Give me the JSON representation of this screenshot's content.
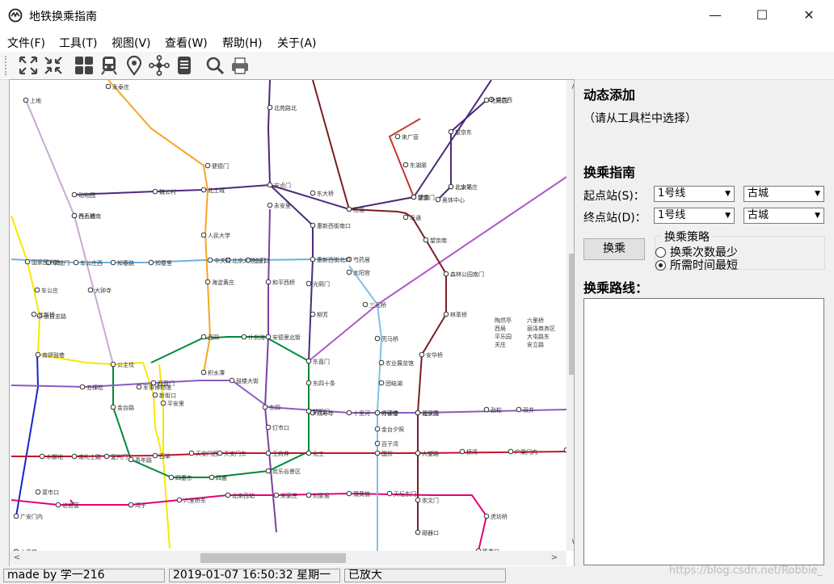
{
  "window": {
    "title": "地铁换乘指南",
    "minimize": "—",
    "maximize": "☐",
    "close": "✕"
  },
  "menu": [
    "文件(F)",
    "工具(T)",
    "视图(V)",
    "查看(W)",
    "帮助(H)",
    "关于(A)"
  ],
  "toolbar": {
    "icons": [
      "zoom-fit-icon",
      "shrink-icon",
      "grid-icon",
      "train-icon",
      "location-pin-icon",
      "network-icon",
      "document-icon",
      "search-icon",
      "printer-icon"
    ]
  },
  "map": {
    "line_colors": {
      "line1": "#c8102e",
      "line2": "#006098",
      "line4": "#008e9c",
      "line5": "#a6217f",
      "line6": "#d29700",
      "line7": "#f6c582",
      "line8": "#009b6b",
      "line9": "#8fc31f",
      "line10": "#0092c7",
      "line13": "#f9e700",
      "line14": "#d5a7a1",
      "line15": "#5b2c6f",
      "batong": "#c23a30",
      "changping": "#de82b2",
      "yizhuang": "#e40077"
    },
    "station_labels": [
      "永泰庄",
      "上地",
      "北苑路北",
      "望京西",
      "望京东",
      "来广营",
      "东湖渠",
      "望京",
      "阜通",
      "望京南",
      "健德门",
      "北土城",
      "安贞门",
      "惠新西街南口",
      "惠新西街北口",
      "和平西桥",
      "光熙门",
      "柳芳",
      "芍药居",
      "太阳宫",
      "三元桥",
      "亮马桥",
      "农业展览馆",
      "团结湖",
      "呼家楼",
      "金台夕照",
      "国贸",
      "大望路",
      "朝阳门",
      "东四十条",
      "东直门",
      "东四",
      "灯市口",
      "王府井",
      "天安门东",
      "天安门西",
      "西单",
      "复兴门",
      "南礼士路",
      "木樨地",
      "军事博物馆",
      "公主坟",
      "五棵松",
      "西直门",
      "新街口",
      "平安里",
      "西四",
      "积水潭",
      "鼓楼大街",
      "安德里北街",
      "什刹海",
      "南锣鼓巷",
      "北新桥",
      "张自忠路",
      "车公庄",
      "车公庄西",
      "阜成门",
      "白石桥南",
      "国家图书馆",
      "动物园",
      "魏公村",
      "人民大学",
      "海淀黄庄",
      "中关村",
      "北京大学东门",
      "五道口",
      "知春路",
      "知春里",
      "大钟寺",
      "西土城",
      "牡丹园",
      "北太平庄",
      "奥体中心",
      "森林公园南门",
      "林萃桥",
      "安华桥",
      "北沙滩",
      "崇文门",
      "磁器口",
      "天坛东门",
      "蒲黄榆",
      "刘家窑",
      "宋家庄",
      "北京西站",
      "六里桥东",
      "湾子",
      "达官营",
      "广安门内",
      "菜市口",
      "虎坊桥",
      "珠市口",
      "桥湾",
      "广渠门内",
      "广渠门外",
      "双井",
      "劲松",
      "潘家园",
      "十里河",
      "分钟寺",
      "成寿寺",
      "化工",
      "百子湾",
      "欢乐谷景区",
      "四惠",
      "四惠东",
      "青年路",
      "十里堡",
      "金台路",
      "红庙",
      "东大桥",
      "永安里",
      "建国门",
      "北京站",
      "陶然亭",
      "六里桥",
      "西局",
      "丽泽商务区",
      "平乐园",
      "大屯路东",
      "关庄",
      "安立路"
    ]
  },
  "panel": {
    "dynamic_title": "动态添加",
    "dynamic_hint": "（请从工具栏中选择）",
    "guide_title": "换乘指南",
    "start_label": "起点站(S)：",
    "end_label": "终点站(D)：",
    "start_line": "1号线",
    "start_station": "古城",
    "end_line": "1号线",
    "end_station": "古城",
    "transfer_button": "换乘",
    "strategy_title": "换乘策略",
    "strategy_options": [
      "换乘次数最少",
      "所需时间最短"
    ],
    "strategy_selected": 1,
    "route_title": "换乘路线："
  },
  "status": {
    "author": "made by 学一216",
    "datetime": "2019-01-07 16:50:32 星期一",
    "zoom_state": "已放大"
  },
  "watermark": "https://blog.csdn.net/Robbie_"
}
